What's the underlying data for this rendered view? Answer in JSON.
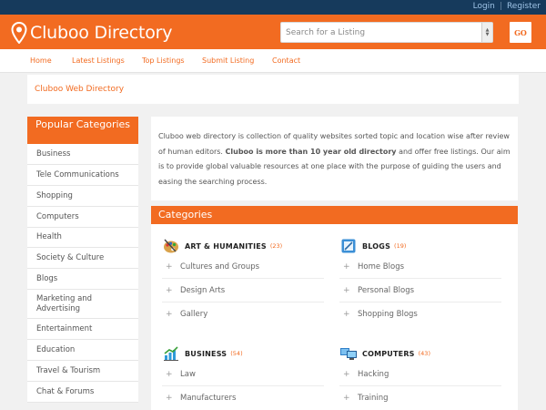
{
  "topbar": {
    "login": "Login",
    "separator": "|",
    "register": "Register"
  },
  "header": {
    "logo_text": "Cluboo Directory",
    "search_placeholder": "Search for a Listing",
    "go_label": "GO",
    "brand_color": "#f26b21"
  },
  "nav": [
    "Home",
    "Latest Listings",
    "Top Listings",
    "Submit Listing",
    "Contact"
  ],
  "breadcrumb": "Cluboo Web Directory",
  "sidebar": {
    "title": "Popular Categories",
    "items": [
      "Business",
      "Tele Communications",
      "Shopping",
      "Computers",
      "Health",
      "Society & Culture",
      "Blogs",
      "Marketing and Advertising",
      "Entertainment",
      "Education",
      "Travel & Tourism",
      "Chat & Forums"
    ]
  },
  "about": {
    "text_1": "Cluboo web directory is collection of quality websites sorted topic and location wise after review of human editors.",
    "bold": "Cluboo is more than 10 year old directory",
    "text_2": "and offer free listings. Our aim is to provide global valuable resources at one place with the purpose of guiding the users and easing the searching process."
  },
  "categories": {
    "title": "Categories",
    "blocks": [
      {
        "name": "ART & HUMANITIES",
        "count": "(23)",
        "icon": "art-palette-icon",
        "subs": [
          "Cultures and Groups",
          "Design Arts",
          "Gallery"
        ]
      },
      {
        "name": "BLOGS",
        "count": "(19)",
        "icon": "blog-notepad-icon",
        "subs": [
          "Home Blogs",
          "Personal Blogs",
          "Shopping Blogs"
        ]
      },
      {
        "name": "BUSINESS",
        "count": "(54)",
        "icon": "business-chart-icon",
        "subs": [
          "Law",
          "Manufacturers"
        ]
      },
      {
        "name": "COMPUTERS",
        "count": "(43)",
        "icon": "computers-monitor-icon",
        "subs": [
          "Hacking",
          "Training"
        ]
      }
    ]
  }
}
